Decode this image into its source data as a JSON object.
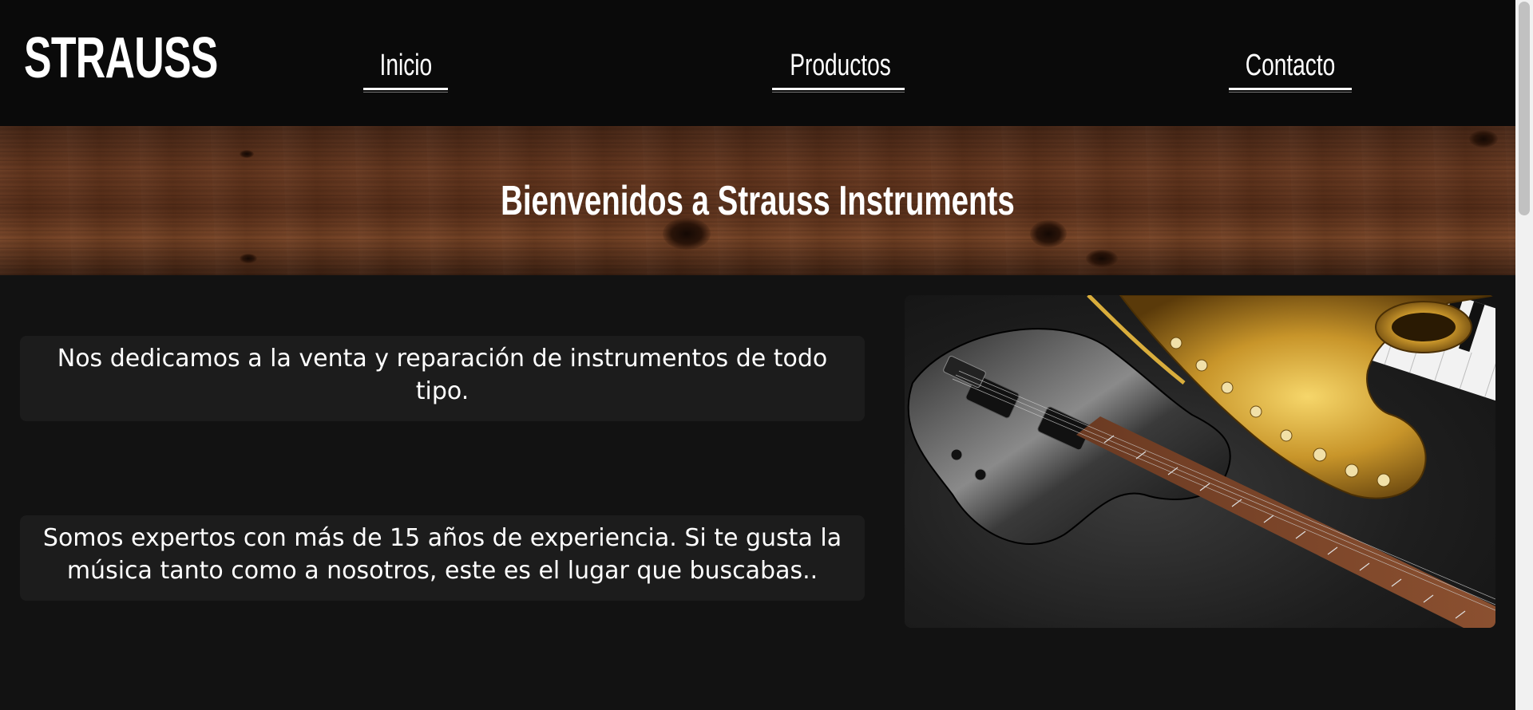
{
  "brand": {
    "logo": "STRAUSS"
  },
  "nav": {
    "items": [
      {
        "label": "Inicio"
      },
      {
        "label": "Productos"
      },
      {
        "label": "Contacto"
      }
    ]
  },
  "banner": {
    "title": "Bienvenidos a Strauss Instruments"
  },
  "main": {
    "paragraphs": [
      {
        "text": "Nos dedicamos a la venta y reparación de instrumentos de todo tipo."
      },
      {
        "text": "Somos expertos con más de 15 años de experiencia. Si te gusta la música tanto como a nosotros, este es el lugar que buscabas.."
      }
    ]
  },
  "colors": {
    "page_background": "#121212",
    "header_background": "#0a0a0a",
    "card_background": "#1c1c1c",
    "text": "#ffffff",
    "wood": "#6b3a20"
  },
  "hero_image": {
    "subject": "electric-guitar-saxophone-piano-photo"
  }
}
